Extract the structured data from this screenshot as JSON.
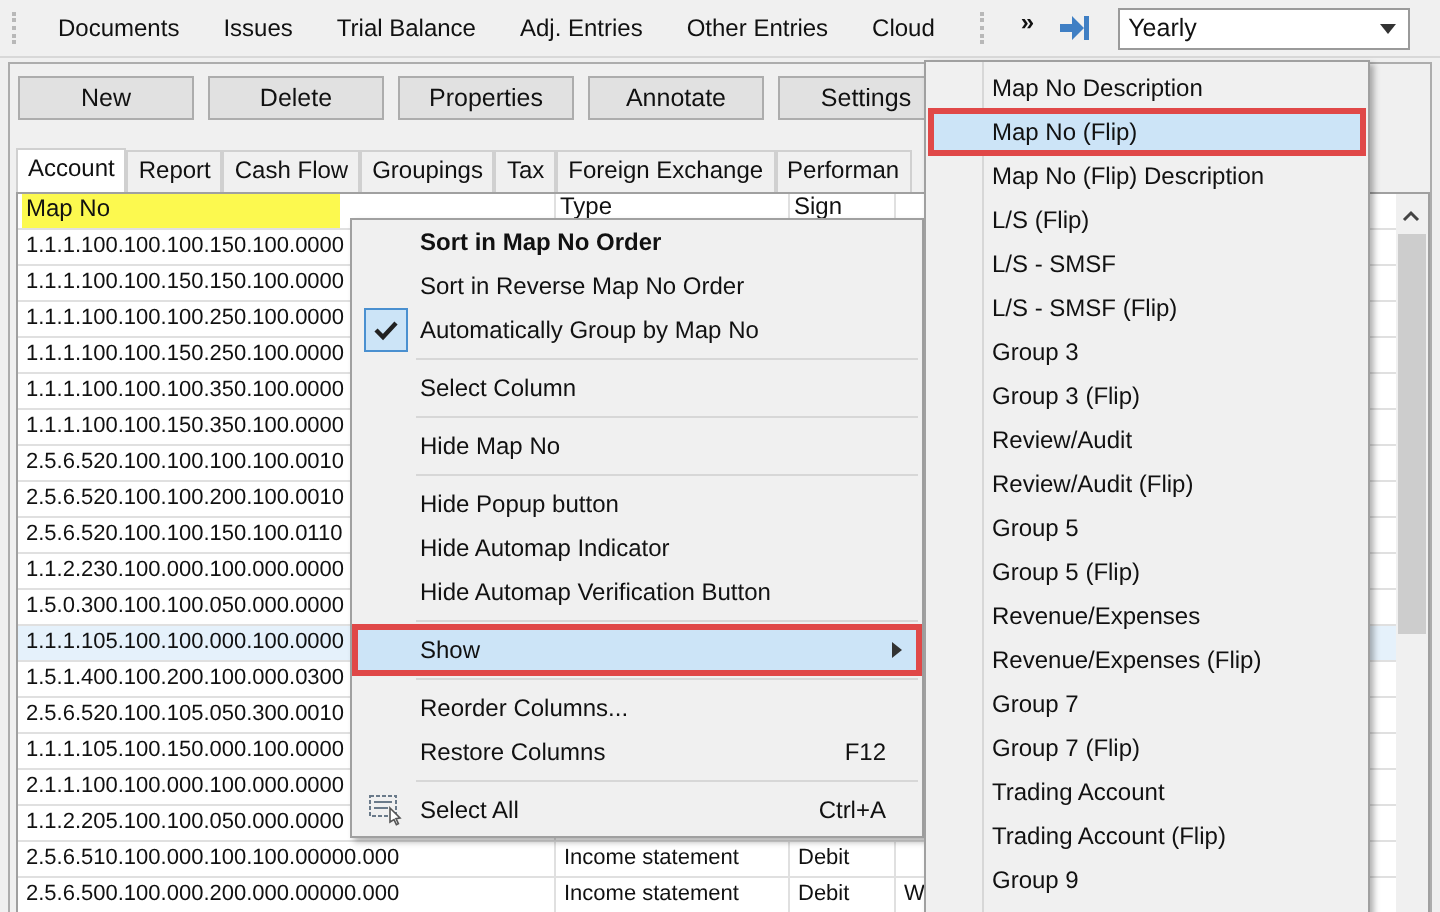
{
  "toolbar": {
    "items": [
      "Documents",
      "Issues",
      "Trial Balance",
      "Adj. Entries",
      "Other Entries",
      "Cloud"
    ],
    "overflow": "»",
    "period": "Yearly"
  },
  "buttons": [
    "New",
    "Delete",
    "Properties",
    "Annotate",
    "Settings"
  ],
  "tabs": [
    {
      "label": "Account",
      "selected": true
    },
    {
      "label": "Report",
      "selected": false
    },
    {
      "label": "Cash Flow",
      "selected": false
    },
    {
      "label": "Groupings",
      "selected": false
    },
    {
      "label": "Tax",
      "selected": false
    },
    {
      "label": "Foreign Exchange",
      "selected": false
    },
    {
      "label": "Performan",
      "selected": false
    }
  ],
  "table": {
    "columns": [
      "Map No",
      "Type",
      "Sign"
    ],
    "rows": [
      {
        "cells": [
          "1.1.1.100.100.100.150.100.0000"
        ],
        "selected": false
      },
      {
        "cells": [
          "1.1.1.100.100.150.150.100.0000"
        ],
        "selected": false
      },
      {
        "cells": [
          "1.1.1.100.100.100.250.100.0000"
        ],
        "selected": false
      },
      {
        "cells": [
          "1.1.1.100.100.150.250.100.0000"
        ],
        "selected": false
      },
      {
        "cells": [
          "1.1.1.100.100.100.350.100.0000"
        ],
        "selected": false
      },
      {
        "cells": [
          "1.1.1.100.100.150.350.100.0000"
        ],
        "selected": false
      },
      {
        "cells": [
          "2.5.6.520.100.100.100.100.0010"
        ],
        "selected": false
      },
      {
        "cells": [
          "2.5.6.520.100.100.200.100.0010"
        ],
        "selected": false
      },
      {
        "cells": [
          "2.5.6.520.100.100.150.100.0110"
        ],
        "selected": false
      },
      {
        "cells": [
          "1.1.2.230.100.000.100.000.0000"
        ],
        "selected": false
      },
      {
        "cells": [
          "1.5.0.300.100.100.050.000.0000"
        ],
        "selected": false
      },
      {
        "cells": [
          "1.1.1.105.100.100.000.100.0000"
        ],
        "selected": true
      },
      {
        "cells": [
          "1.5.1.400.100.200.100.000.0300"
        ],
        "selected": false
      },
      {
        "cells": [
          "2.5.6.520.100.105.050.300.0010"
        ],
        "selected": false
      },
      {
        "cells": [
          "1.1.1.105.100.150.000.100.0000"
        ],
        "selected": false
      },
      {
        "cells": [
          "2.1.1.100.100.000.100.000.0000"
        ],
        "selected": false
      },
      {
        "cells": [
          "1.1.2.205.100.100.050.000.0000"
        ],
        "selected": false
      },
      {
        "cells": [
          "2.5.6.510.100.000.100.100.00000.000",
          "Income statement",
          "Debit"
        ],
        "selected": false
      },
      {
        "cells": [
          "2.5.6.500.100.000.200.000.00000.000",
          "Income statement",
          "Debit",
          "W"
        ],
        "selected": false
      }
    ]
  },
  "context_menu": {
    "groups": [
      [
        {
          "label": "Sort in Map No Order",
          "bold": true,
          "checked": false
        },
        {
          "label": "Sort in Reverse Map No Order",
          "bold": false,
          "checked": false
        },
        {
          "label": "Automatically Group by Map No",
          "bold": false,
          "checked": true
        }
      ],
      [
        {
          "label": "Select Column",
          "bold": false,
          "checked": false
        }
      ],
      [
        {
          "label": "Hide Map No",
          "bold": false,
          "checked": false
        }
      ],
      [
        {
          "label": "Hide Popup button",
          "bold": false,
          "checked": false
        },
        {
          "label": "Hide Automap Indicator",
          "bold": false,
          "checked": false
        },
        {
          "label": "Hide Automap Verification Button",
          "bold": false,
          "checked": false
        }
      ],
      [
        {
          "label": "Show",
          "bold": false,
          "checked": false,
          "submenu": true,
          "selected": true
        }
      ],
      [
        {
          "label": "Reorder Columns...",
          "bold": false,
          "checked": false
        },
        {
          "label": "Restore Columns",
          "bold": false,
          "checked": false,
          "shortcut": "F12"
        }
      ],
      [
        {
          "label": "Select All",
          "bold": false,
          "checked": false,
          "shortcut": "Ctrl+A",
          "icon": true
        }
      ]
    ]
  },
  "submenu": {
    "items": [
      {
        "label": "Map No Description",
        "selected": false
      },
      {
        "label": "Map No (Flip)",
        "selected": true
      },
      {
        "label": "Map No (Flip) Description",
        "selected": false
      },
      {
        "label": "L/S (Flip)",
        "selected": false
      },
      {
        "label": "L/S - SMSF",
        "selected": false
      },
      {
        "label": "L/S - SMSF (Flip)",
        "selected": false
      },
      {
        "label": "Group 3",
        "selected": false
      },
      {
        "label": "Group 3 (Flip)",
        "selected": false
      },
      {
        "label": "Review/Audit",
        "selected": false
      },
      {
        "label": "Review/Audit (Flip)",
        "selected": false
      },
      {
        "label": "Group 5",
        "selected": false
      },
      {
        "label": "Group 5 (Flip)",
        "selected": false
      },
      {
        "label": "Revenue/Expenses",
        "selected": false
      },
      {
        "label": "Revenue/Expenses (Flip)",
        "selected": false
      },
      {
        "label": "Group 7",
        "selected": false
      },
      {
        "label": "Group 7 (Flip)",
        "selected": false
      },
      {
        "label": "Trading Account",
        "selected": false
      },
      {
        "label": "Trading Account (Flip)",
        "selected": false
      },
      {
        "label": "Group 9",
        "selected": false
      }
    ]
  }
}
